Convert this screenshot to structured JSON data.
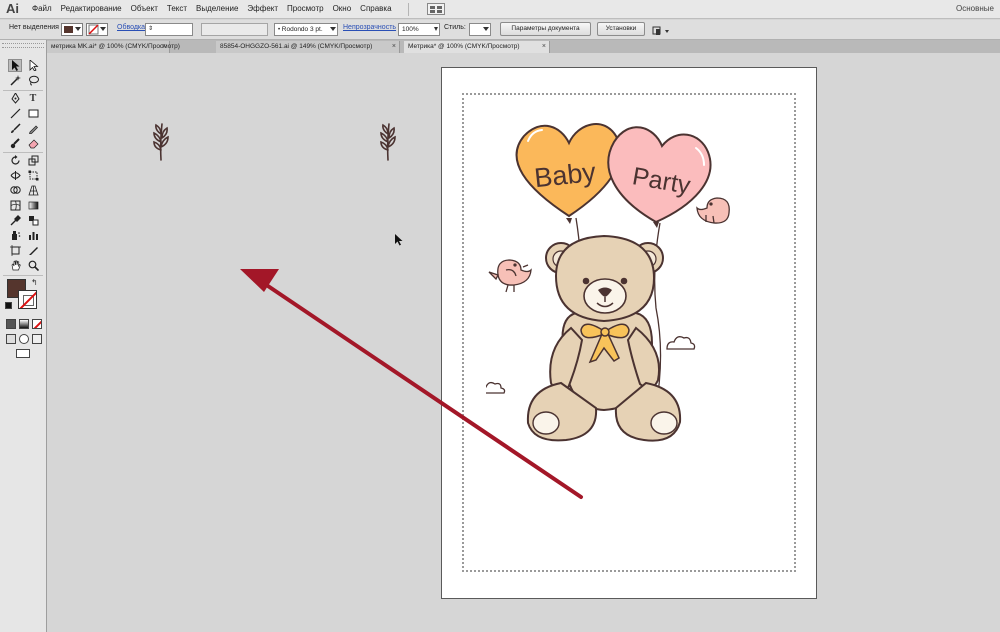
{
  "app": {
    "logo": "Ai",
    "workspace": "Основные"
  },
  "menu": [
    "Файл",
    "Редактирование",
    "Объект",
    "Текст",
    "Выделение",
    "Эффект",
    "Просмотр",
    "Окно",
    "Справка"
  ],
  "control_bar": {
    "selection_status": "Нет выделения",
    "stroke_label": "Обводка:",
    "brush_value": "Rodondo 3 pt.",
    "opacity_label": "Непрозрачность",
    "opacity_value": "100%",
    "style_label": "Стиль:",
    "doc_settings_button": "Параметры документа",
    "preferences_button": "Установки"
  },
  "tabs": [
    {
      "label": "метрика MK.ai* @ 100% (CMYK/Просмотр)",
      "close": "×",
      "active": false
    },
    {
      "label": "85854-OHGGZO-561.ai @ 149% (CMYK/Просмотр)",
      "close": "×",
      "active": false
    },
    {
      "label": "Метрика* @ 100% (CMYK/Просмотр)",
      "close": "×",
      "active": true
    }
  ],
  "artboard": {
    "balloon_left_text": "Baby",
    "balloon_right_text": "Party"
  },
  "colors": {
    "fill": "#55352d",
    "arrow": "#a31728",
    "balloon_left": "#fbb85a",
    "balloon_right": "#fbbcbd",
    "bear": "#e6d2b5",
    "bow": "#f8c35a",
    "outline": "#4b3331"
  },
  "icons": [
    "selection-tool-icon",
    "direct-selection-tool-icon",
    "pen-tool-icon",
    "type-tool-icon",
    "brush-tool-icon",
    "zoom-tool-icon",
    "hand-tool-icon",
    "sprig-icon",
    "cursor-icon",
    "red-arrow-annotation"
  ]
}
